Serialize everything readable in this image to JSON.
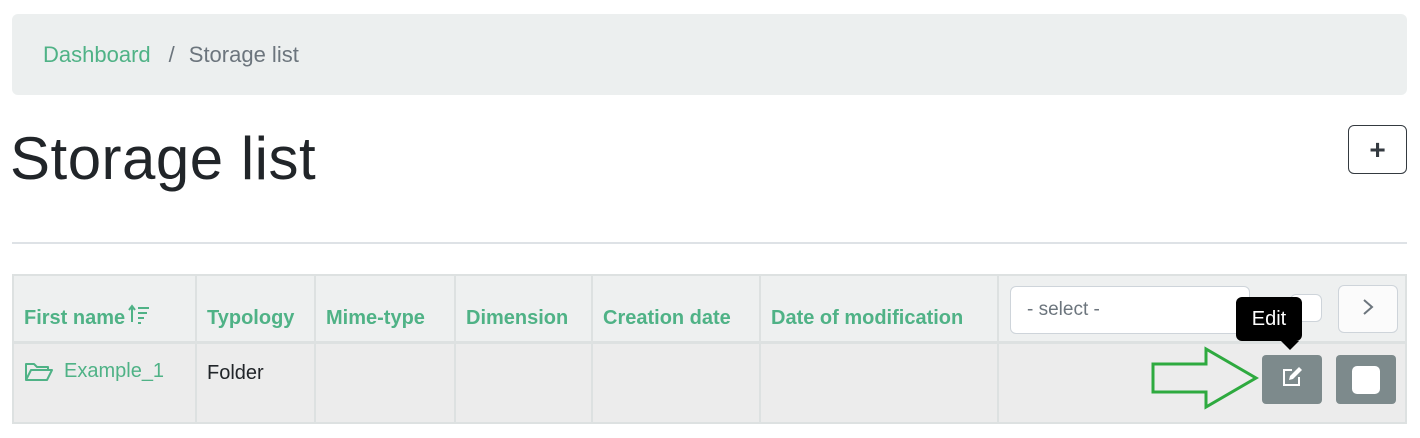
{
  "breadcrumb": {
    "home_label": "Dashboard",
    "separator": "/",
    "current_label": "Storage list"
  },
  "page": {
    "title": "Storage list",
    "add_button_label": "+"
  },
  "table": {
    "columns": [
      "First name",
      "Typology",
      "Mime-type",
      "Dimension",
      "Creation date",
      "Date of modification"
    ],
    "select_placeholder": "- select -",
    "rows": [
      {
        "first_name": "Example_1",
        "typology": "Folder",
        "mime_type": "",
        "dimension": "",
        "creation_date": "",
        "date_of_modification": ""
      }
    ]
  },
  "tooltip": {
    "text": "Edit"
  },
  "icons": {
    "sort": "sort-ascending-icon",
    "folder": "folder-open-icon",
    "next": "chevron-right-icon",
    "edit": "edit-icon",
    "annotation": "arrow-right-icon"
  },
  "colors": {
    "accent": "#4fb286",
    "breadcrumb_bg": "#ecefef",
    "button_gray": "#7d8a8c",
    "annotation_arrow": "#2eaa3f"
  }
}
